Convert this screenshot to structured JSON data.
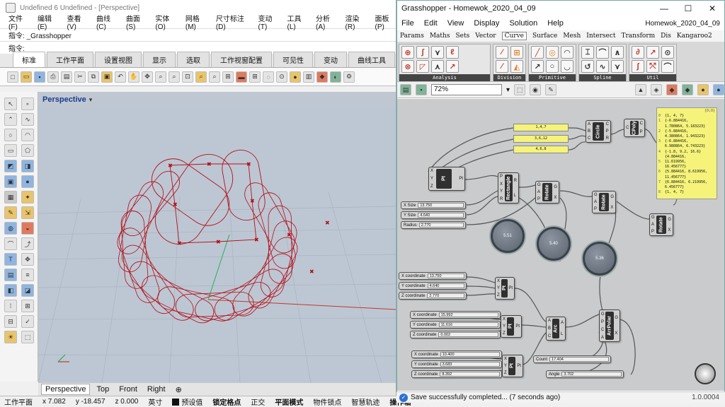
{
  "rhino": {
    "window_title": "Undefined 6 Undefined - [Perspective]",
    "menu": [
      "文件(F)",
      "编辑(E)",
      "查看(V)",
      "曲线(C)",
      "曲面(S)",
      "实体(O)",
      "网格(M)",
      "尺寸标注(D)",
      "变动(T)",
      "工具(L)",
      "分析(A)",
      "渲染(R)",
      "面板(P)"
    ],
    "command_history": "指令: _Grasshopper",
    "command_prompt": "指令:",
    "toolbar_tabs": [
      "标准",
      "工作平面",
      "设置视图",
      "显示",
      "选取",
      "工作视窗配置",
      "可见性",
      "变动",
      "曲线工具"
    ],
    "active_tab": "标准",
    "viewport_name": "Perspective",
    "viewport_tabs": [
      "Perspective",
      "Top",
      "Front",
      "Right"
    ],
    "status": {
      "cplane": "工作平面",
      "x": "x 7.082",
      "y": "y -18.457",
      "z": "z 0.000",
      "unit": "英寸",
      "layer": "预设值",
      "snap": "锁定格点",
      "ortho": "正交",
      "planar": "平面模式",
      "osnap": "物件锁点",
      "smarttrack": "智慧轨迹",
      "gumball": "操作轴"
    },
    "curve_color": "#b2101a"
  },
  "gh": {
    "window_title": "Grasshopper - Homewok_2020_04_09",
    "menu": [
      "File",
      "Edit",
      "View",
      "Display",
      "Solution",
      "Help"
    ],
    "doc_name": "Homewok_2020_04_09",
    "tabs": [
      "Params",
      "Maths",
      "Sets",
      "Vector",
      "Curve",
      "Surface",
      "Mesh",
      "Intersect",
      "Transform",
      "Dis",
      "Kangaroo2"
    ],
    "active_tab": "Curve",
    "ribbon_groups": [
      "Analysis",
      "Division",
      "Primitive",
      "Spline",
      "Util"
    ],
    "zoom": "72%",
    "status_message": "Save successfully completed... (7 seconds ago)",
    "version": "1.0.0004",
    "panels_text": [
      "1,4,7",
      "3,6,12",
      "4,6,8"
    ],
    "components": {
      "circle": "Circle",
      "cpoly": "CPoly",
      "pt1": "Pt",
      "rectangle": "Rectangle",
      "rotate1": "Rotate",
      "rotate2": "Rotate",
      "rotate3": "Rotate",
      "pt2": "Pt",
      "pt3": "Pt",
      "pt4": "Pt",
      "arc": "Arc",
      "arrpolar": "ArrPolar"
    },
    "sliders": [
      {
        "label": "X Size",
        "value": "13.750"
      },
      {
        "label": "Y Size",
        "value": "4.640"
      },
      {
        "label": "Radius",
        "value": "2.770"
      },
      {
        "label": "X coordinate",
        "value": "13.750"
      },
      {
        "label": "Y coordinate",
        "value": "4.640"
      },
      {
        "label": "Z coordinate",
        "value": "2.770"
      },
      {
        "label": "X coordinate",
        "value": "15.992"
      },
      {
        "label": "Y coordinate",
        "value": "11.616"
      },
      {
        "label": "Z coordinate",
        "value": "0.002"
      },
      {
        "label": "X coordinate",
        "value": "10.400"
      },
      {
        "label": "Y coordinate",
        "value": "3.683"
      },
      {
        "label": "Z coordinate",
        "value": "8.392"
      },
      {
        "label": "Count",
        "value": "17.404"
      },
      {
        "label": "Angle",
        "value": "3.702"
      }
    ],
    "knobs": [
      "5.51",
      "5.40",
      "5.36"
    ],
    "output_panel": {
      "header": "{0;0}",
      "rows": [
        {
          "i": "0",
          "t": "{1, 4, 7}"
        },
        {
          "i": "1",
          "t": "{-6.884416,"
        },
        {
          "i": "",
          "t": "1.780864, 5.183223}"
        },
        {
          "i": "2",
          "t": "{-5.884416,"
        },
        {
          "i": "",
          "t": "4.380864, 1.943223}"
        },
        {
          "i": "3",
          "t": "{-6.884416,"
        },
        {
          "i": "",
          "t": "6.980864, 6.743223}"
        },
        {
          "i": "4",
          "t": "{-1.8, 9.2, 16.6}"
        },
        {
          "i": "",
          "t": "{4.884416,"
        },
        {
          "i": "5",
          "t": "11.619956,"
        },
        {
          "i": "",
          "t": "16.456777}"
        },
        {
          "i": "6",
          "t": "{5.884416, 8.619956,"
        },
        {
          "i": "",
          "t": "11.456777}"
        },
        {
          "i": "7",
          "t": "{6.884416, 6.219956,"
        },
        {
          "i": "",
          "t": "6.456777}"
        },
        {
          "i": "8",
          "t": "{1, 4, 7}"
        }
      ]
    }
  }
}
